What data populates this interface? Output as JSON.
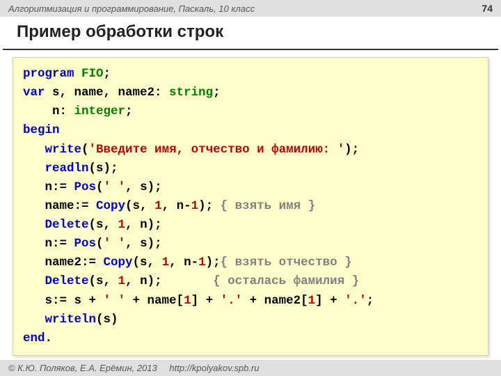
{
  "header": {
    "course": "Алгоритмизация и программирование, Паскаль, 10 класс",
    "page": "74"
  },
  "title": "Пример обработки строк",
  "code": {
    "l01": {
      "kw": "program ",
      "id": "FIO",
      "t": ";"
    },
    "l02": {
      "kw": "var ",
      "a": "s, name, name2: ",
      "ty": "string",
      "t": ";"
    },
    "l03": {
      "pad": "    ",
      "a": "n: ",
      "ty": "integer",
      "t": ";"
    },
    "l04": {
      "kw": "begin"
    },
    "l05": {
      "pad": "   ",
      "fn": "write",
      "a": "(",
      "s": "'Введите имя, отчество и фамилию: '",
      "t": ");"
    },
    "l06": {
      "pad": "   ",
      "fn": "readln",
      "t": "(s);"
    },
    "l07": {
      "pad": "   ",
      "a": "n:= ",
      "fn": "Pos",
      "b": "(",
      "s": "' '",
      "t": ", s);"
    },
    "l08": {
      "pad": "   ",
      "a": "name:= ",
      "fn": "Copy",
      "b": "(s, ",
      "n1": "1",
      "c": ", n-",
      "n2": "1",
      "d": "); ",
      "cm": "{ взять имя }"
    },
    "l09": {
      "pad": "   ",
      "fn": "Delete",
      "a": "(s, ",
      "n1": "1",
      "b": ", n);"
    },
    "l10": {
      "pad": "   ",
      "a": "n:= ",
      "fn": "Pos",
      "b": "(",
      "s": "' '",
      "t": ", s);"
    },
    "l11": {
      "pad": "   ",
      "a": "name2:= ",
      "fn": "Copy",
      "b": "(s, ",
      "n1": "1",
      "c": ", n-",
      "n2": "1",
      "d": ");",
      "cm": "{ взять отчество }"
    },
    "l12": {
      "pad": "   ",
      "fn": "Delete",
      "a": "(s, ",
      "n1": "1",
      "b": ", n);       ",
      "cm": "{ осталась фамилия }"
    },
    "l13": {
      "pad": "   ",
      "a": "s:= s + ",
      "s1": "' '",
      "b": " + name[",
      "n1": "1",
      "c": "] + ",
      "s2": "'.'",
      "d": " + name2[",
      "n2": "1",
      "e": "] + ",
      "s3": "'.'",
      "f": ";"
    },
    "l14": {
      "pad": "   ",
      "fn": "writeln",
      "t": "(s)"
    },
    "l15": {
      "kw": "end",
      "t": "."
    }
  },
  "footer": {
    "copyright": "© К.Ю. Поляков, Е.А. Ерёмин, 2013",
    "url": "http://kpolyakov.spb.ru"
  }
}
